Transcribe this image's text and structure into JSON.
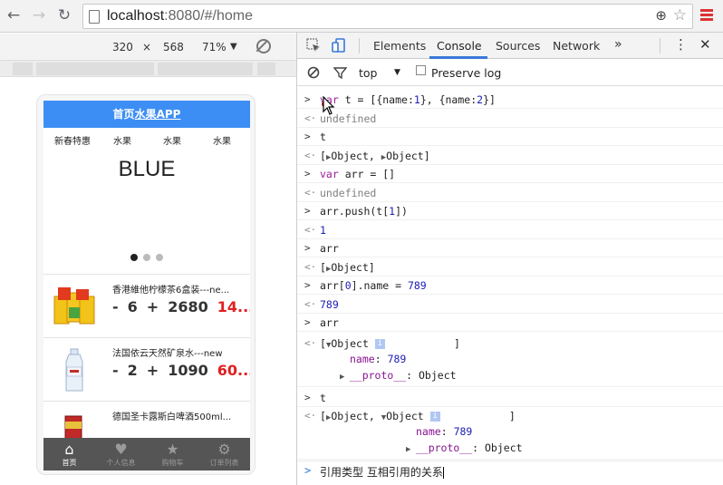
{
  "browser": {
    "url_host": "localhost",
    "url_rest": ":8080/#/home"
  },
  "device_toolbar": {
    "width": "320",
    "times": "×",
    "height": "568",
    "zoom": "71%",
    "zoom_caret": "▼"
  },
  "app": {
    "header_plain": "首页",
    "header_bold": "水果APP",
    "categories": [
      "新春特惠",
      "水果",
      "水果",
      "水果"
    ],
    "banner_text": "BLUE",
    "products": [
      {
        "name": "香港維他柠檬茶6盒装---ne...",
        "minus": "-",
        "qty": "6",
        "plus": "+",
        "count": "2680",
        "price": "14..."
      },
      {
        "name": "法国依云天然矿泉水---new",
        "minus": "-",
        "qty": "2",
        "plus": "+",
        "count": "1090",
        "price": "60..."
      },
      {
        "name": "德国圣卡露斯白啤酒500ml..."
      }
    ],
    "tabs": [
      {
        "icon": "home-icon",
        "glyph": "⌂",
        "label": "首页"
      },
      {
        "icon": "heart-icon",
        "glyph": "♥",
        "label": "个人信息"
      },
      {
        "icon": "star-icon",
        "glyph": "★",
        "label": "购物车"
      },
      {
        "icon": "gear-icon",
        "glyph": "⚙",
        "label": "订单列表"
      }
    ]
  },
  "devtools": {
    "tabs": [
      "Elements",
      "Console",
      "Sources",
      "Network"
    ],
    "more": "»",
    "context": "top",
    "context_caret": "▼",
    "preserve_log": "Preserve log",
    "console_lines": [
      {
        "type": "in",
        "parts": [
          [
            "kw",
            "var"
          ],
          [
            "p",
            " t = [{"
          ],
          [
            "p",
            "name:"
          ],
          [
            "num",
            "1"
          ],
          [
            "p",
            "}, {name:"
          ],
          [
            "num",
            "2"
          ],
          [
            "p",
            "}]"
          ]
        ]
      },
      {
        "type": "out",
        "parts": [
          [
            "undef",
            "undefined"
          ]
        ]
      },
      {
        "type": "in",
        "parts": [
          [
            "p",
            "t"
          ]
        ]
      },
      {
        "type": "out",
        "parts": [
          [
            "p",
            "["
          ],
          [
            "tri",
            "▶"
          ],
          [
            "p",
            "Object, "
          ],
          [
            "tri",
            "▶"
          ],
          [
            "p",
            "Object]"
          ]
        ]
      },
      {
        "type": "in",
        "parts": [
          [
            "kw",
            "var"
          ],
          [
            "p",
            " arr = []"
          ]
        ]
      },
      {
        "type": "out",
        "parts": [
          [
            "undef",
            "undefined"
          ]
        ]
      },
      {
        "type": "in",
        "parts": [
          [
            "p",
            "arr.push(t["
          ],
          [
            "num",
            "1"
          ],
          [
            "p",
            "])"
          ]
        ]
      },
      {
        "type": "out",
        "parts": [
          [
            "num",
            "1"
          ]
        ]
      },
      {
        "type": "in",
        "parts": [
          [
            "p",
            "arr"
          ]
        ]
      },
      {
        "type": "out",
        "parts": [
          [
            "p",
            "["
          ],
          [
            "tri",
            "▶"
          ],
          [
            "p",
            "Object]"
          ]
        ]
      },
      {
        "type": "in",
        "parts": [
          [
            "p",
            "arr["
          ],
          [
            "num",
            "0"
          ],
          [
            "p",
            "].name = "
          ],
          [
            "num",
            "789"
          ]
        ]
      },
      {
        "type": "out",
        "parts": [
          [
            "num",
            "789"
          ]
        ]
      },
      {
        "type": "in",
        "parts": [
          [
            "p",
            "arr"
          ]
        ]
      }
    ],
    "arr_expanded": {
      "open": "[",
      "tri": "▼",
      "obj": "Object",
      "close": "]",
      "name_key": "name",
      "name_val": "789",
      "proto": "__proto__",
      "proto_val": ": Object"
    },
    "t_line": {
      "in": "t",
      "open": "[",
      "tri1": "▶",
      "obj1": "Object, ",
      "tri2": "▼",
      "obj2": "Object",
      "close": "]",
      "name_key": "name",
      "name_val": "789",
      "proto": "__proto__",
      "proto_val": ": Object"
    },
    "input_text": "引用类型  互相引用的关系"
  }
}
